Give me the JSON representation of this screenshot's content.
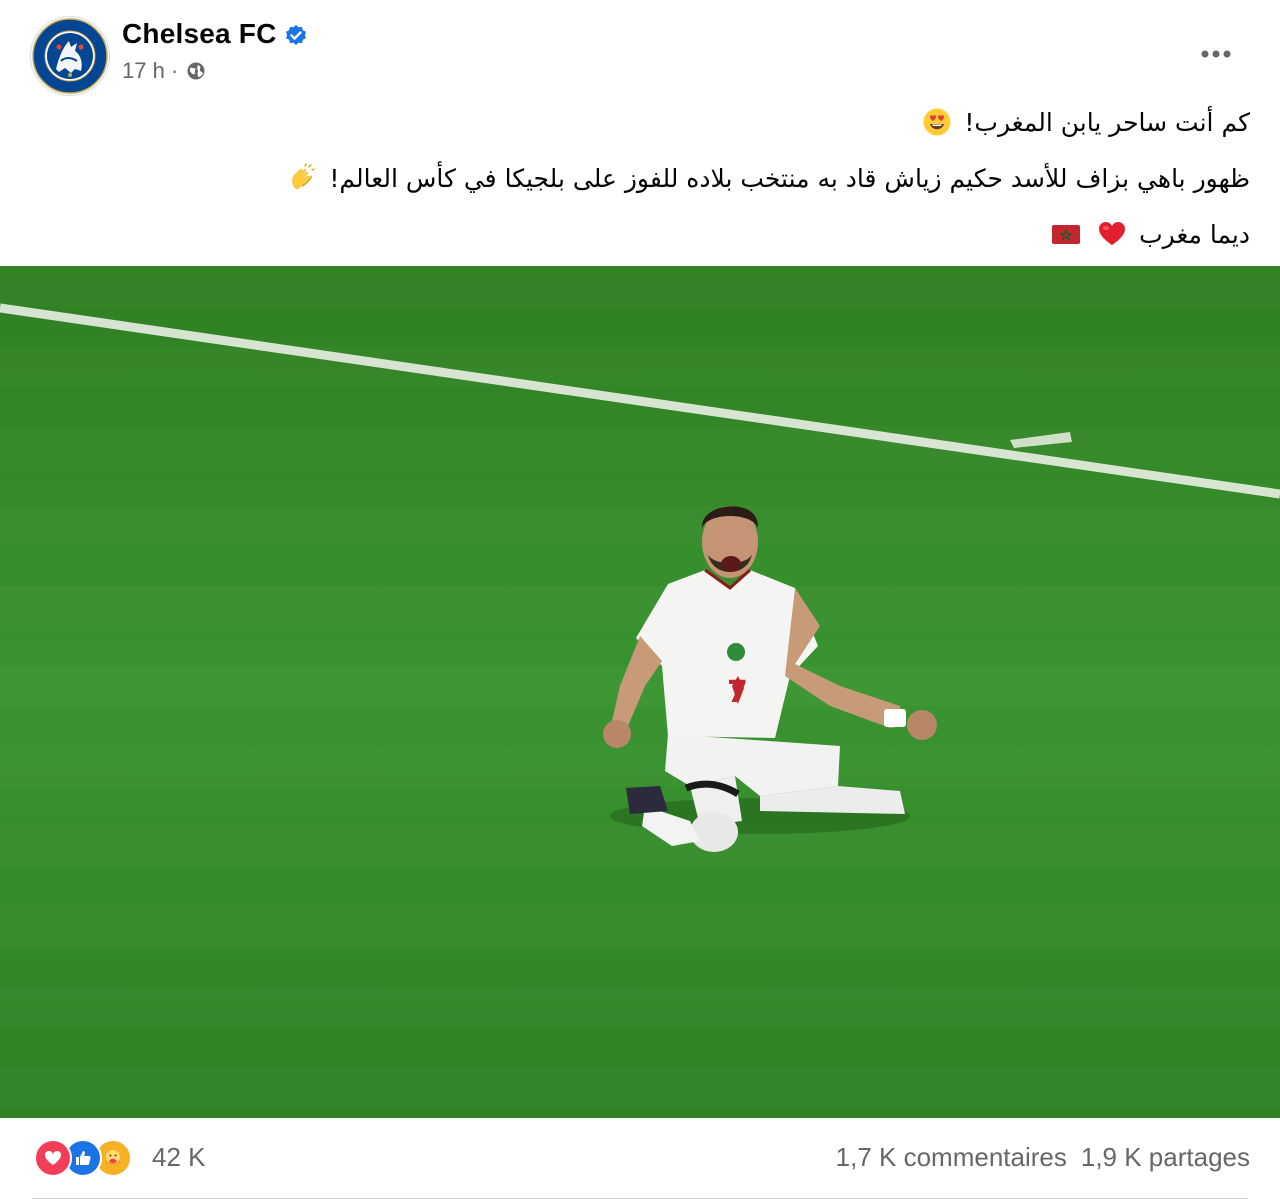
{
  "post": {
    "page_name": "Chelsea FC",
    "verified": true,
    "timestamp": "17 h",
    "separator": "·",
    "audience_icon": "globe-icon",
    "more_icon": "more-horizontal-icon",
    "avatar_logo_lettering": "CHELSEA FOOTBALL CLUB",
    "caption": {
      "line1": "كم أنت ساحر يابن المغرب!",
      "line1_emoji": "heart-eyes-emoji",
      "line2": "ظهور باهي بزاف للأسد حكيم زياش قاد به منتخب بلاده للفوز على بلجيكا في كأس العالم!",
      "line2_emoji": "clapping-hands-emoji",
      "line3": "ديما مغرب",
      "line3_emojis": [
        "red-heart-emoji",
        "morocco-flag-emoji"
      ]
    },
    "photo": {
      "subject": "football-player-celebrating-on-pitch",
      "jersey_number": "7"
    }
  },
  "footer": {
    "reaction_icons": [
      "love-reaction-icon",
      "like-reaction-icon",
      "care-reaction-icon"
    ],
    "reaction_count": "42 K",
    "comments": "1,7 K commentaires",
    "shares": "1,9 K partages"
  },
  "colors": {
    "brand_blue": "#034694",
    "verified_blue": "#1b74e4",
    "secondary_text": "#65676b",
    "pitch_green": "#338a27"
  }
}
